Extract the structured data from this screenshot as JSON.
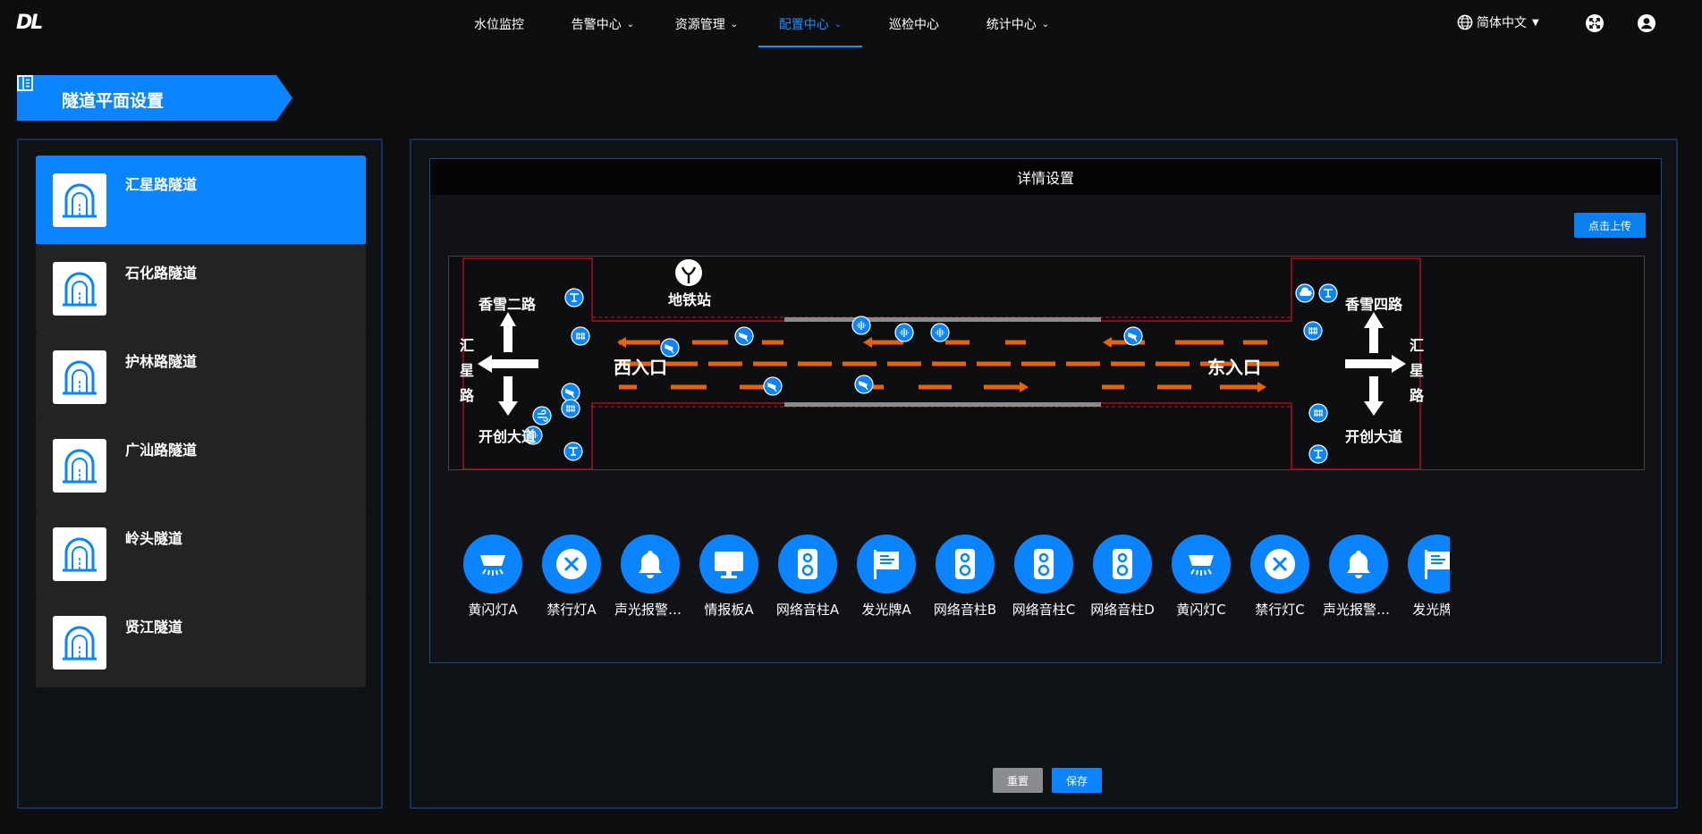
{
  "header": {
    "logo": "DL",
    "nav": [
      {
        "label": "水位监控",
        "has_menu": false,
        "active": false
      },
      {
        "label": "告警中心",
        "has_menu": true,
        "active": false
      },
      {
        "label": "资源管理",
        "has_menu": true,
        "active": false
      },
      {
        "label": "配置中心",
        "has_menu": true,
        "active": true
      },
      {
        "label": "巡检中心",
        "has_menu": false,
        "active": false
      },
      {
        "label": "统计中心",
        "has_menu": true,
        "active": false
      }
    ],
    "language": "简体中文",
    "icons": [
      "globe-icon",
      "fullscreen-icon",
      "user-icon"
    ]
  },
  "page_title": "隧道平面设置",
  "tunnels": [
    {
      "name": "汇星路隧道",
      "selected": true
    },
    {
      "name": "石化路隧道",
      "selected": false
    },
    {
      "name": "护林路隧道",
      "selected": false
    },
    {
      "name": "广汕路隧道",
      "selected": false
    },
    {
      "name": "岭头隧道",
      "selected": false
    },
    {
      "name": "贤江隧道",
      "selected": false
    }
  ],
  "detail": {
    "title": "详情设置",
    "upload_label": "点击上传",
    "map": {
      "metro": "地铁站",
      "west_entrance": "西入口",
      "east_entrance": "东入口",
      "west_top": "香雪二路",
      "west_bottom": "开创大道",
      "west_road": "汇星路",
      "east_top": "香雪四路",
      "east_bottom": "开创大道",
      "east_road": "汇星路"
    },
    "devices": [
      {
        "label": "黄闪灯A",
        "icon": "strobe-light-icon"
      },
      {
        "label": "禁行灯A",
        "icon": "no-entry-icon"
      },
      {
        "label": "声光报警器A",
        "icon": "bell-icon"
      },
      {
        "label": "情报板A",
        "icon": "monitor-icon"
      },
      {
        "label": "网络音柱A",
        "icon": "speaker-icon"
      },
      {
        "label": "发光牌A",
        "icon": "sign-board-icon"
      },
      {
        "label": "网络音柱B",
        "icon": "speaker-icon"
      },
      {
        "label": "网络音柱C",
        "icon": "speaker-icon"
      },
      {
        "label": "网络音柱D",
        "icon": "speaker-icon"
      },
      {
        "label": "黄闪灯C",
        "icon": "strobe-light-icon"
      },
      {
        "label": "禁行灯C",
        "icon": "no-entry-icon"
      },
      {
        "label": "声光报警器C",
        "icon": "bell-icon"
      },
      {
        "label": "发光牌C",
        "icon": "sign-board-icon"
      }
    ]
  },
  "buttons": {
    "reset": "重置",
    "save": "保存"
  },
  "colors": {
    "accent": "#0a85ff",
    "lane_arrow": "#e8620c",
    "boundary": "#d0101a"
  }
}
